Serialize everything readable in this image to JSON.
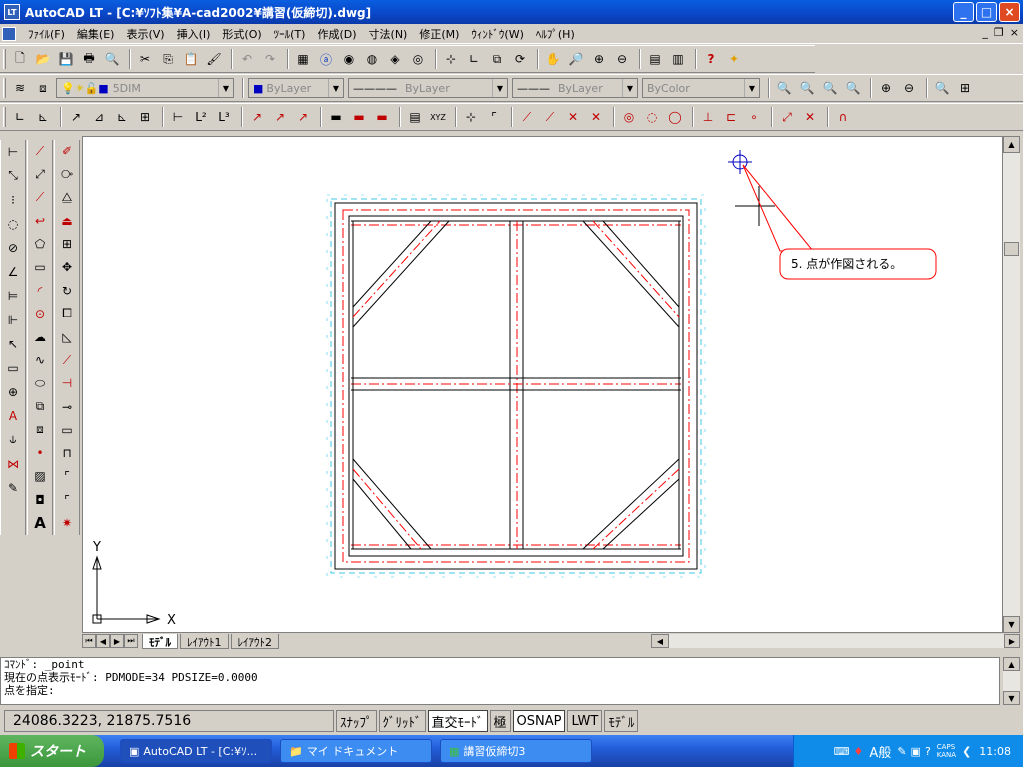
{
  "window": {
    "title": "AutoCAD LT - [C:¥ｿﾌﾄ集¥A-cad2002¥講習(仮締切).dwg]"
  },
  "menu": [
    "ﾌｧｲﾙ(F)",
    "編集(E)",
    "表示(V)",
    "挿入(I)",
    "形式(O)",
    "ﾂｰﾙ(T)",
    "作成(D)",
    "寸法(N)",
    "修正(M)",
    "ｳｨﾝﾄﾞｳ(W)",
    "ﾍﾙﾌﾟ(H)"
  ],
  "layer_bar": {
    "layer": "5DIM",
    "color": "ByLayer",
    "linetype": "ByLayer",
    "lineweight": "ByLayer",
    "plotstyle": "ByColor"
  },
  "callout": "5. 点が作図される。",
  "ucs": {
    "x": "X",
    "y": "Y"
  },
  "tabs": [
    "ﾓﾃﾞﾙ",
    "ﾚｲｱｳﾄ1",
    "ﾚｲｱｳﾄ2"
  ],
  "command": {
    "line1": "ｺﾏﾝﾄﾞ: _point",
    "line2": "現在の点表示ﾓｰﾄﾞ:  PDMODE=34  PDSIZE=0.0000",
    "line3": "点を指定:"
  },
  "status": {
    "coords": "24086.3223, 21875.7516",
    "buttons": [
      "ｽﾅｯﾌﾟ",
      "ｸﾞﾘｯﾄﾞ",
      "直交ﾓｰﾄﾞ",
      "極",
      "OSNAP",
      "LWT",
      "ﾓﾃﾞﾙ"
    ]
  },
  "taskbar": {
    "start": "スタート",
    "tasks": [
      "AutoCAD LT - [C:¥ｿ...",
      "マイ ドキュメント",
      "講習仮締切3"
    ],
    "clock": "11:08",
    "caps": "CAPS",
    "kana": "KANA",
    "ime": "A般"
  },
  "colors": {
    "red": "#ff0000",
    "cyan": "#40c8e8",
    "blue": "#0000c0"
  }
}
